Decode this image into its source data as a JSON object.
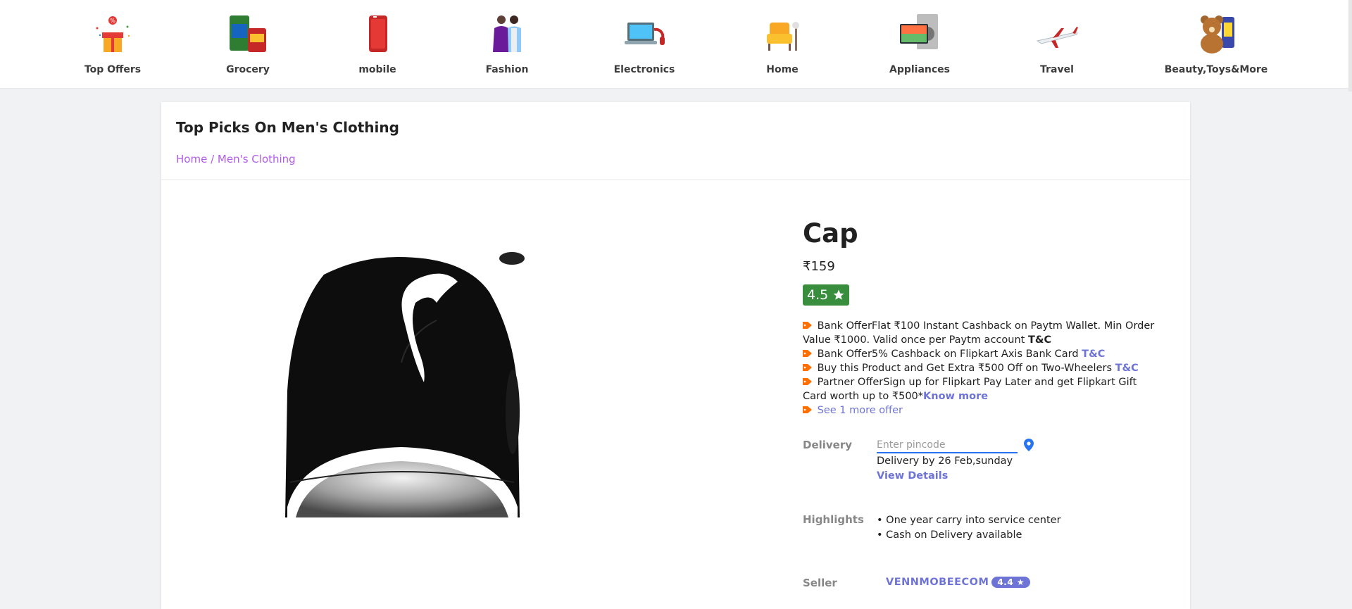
{
  "categories": [
    {
      "label": "Top Offers",
      "icon": "gift-offers-icon"
    },
    {
      "label": "Grocery",
      "icon": "grocery-icon"
    },
    {
      "label": "mobile",
      "icon": "mobile-phone-icon"
    },
    {
      "label": "Fashion",
      "icon": "fashion-icon"
    },
    {
      "label": "Electronics",
      "icon": "laptop-icon"
    },
    {
      "label": "Home",
      "icon": "armchair-icon"
    },
    {
      "label": "Appliances",
      "icon": "appliances-icon"
    },
    {
      "label": "Travel",
      "icon": "airplane-icon"
    },
    {
      "label": "Beauty,Toys&More",
      "icon": "teddy-bear-icon"
    }
  ],
  "section": {
    "title": "Top Picks On Men's Clothing",
    "breadcrumb": [
      "Home",
      "/",
      "Men's Clothing"
    ]
  },
  "product": {
    "name": "Cap",
    "price": "₹159",
    "rating": "4.5",
    "image_icon": "black-cap-icon"
  },
  "offers": [
    {
      "text": "Bank OfferFlat ₹100 Instant Cashback on Paytm Wallet. Min Order Value ₹1000. Valid once per Paytm account ",
      "link": "T&C"
    },
    {
      "text": "Bank Offer5% Cashback on Flipkart Axis Bank Card ",
      "link": "T&C"
    },
    {
      "text": "Buy this Product and Get Extra ₹500 Off on Two-Wheelers ",
      "link": "T&C"
    },
    {
      "text": "Partner OfferSign up for Flipkart Pay Later and get Flipkart Gift Card worth up to ₹500*",
      "link": "Know more"
    },
    {
      "text": "",
      "link": "See 1 more offer"
    }
  ],
  "delivery": {
    "label": "Delivery",
    "placeholder": "Enter pincode",
    "text": "Delivery by 26 Feb,sunday",
    "view_details": "View Details"
  },
  "highlights": {
    "label": "Highlights",
    "items": [
      "One year carry into service center",
      "Cash on Delivery available"
    ]
  },
  "seller": {
    "label": "Seller",
    "name": "VENNMOBEECOM",
    "rating": "4.4 ★"
  },
  "colors": {
    "rating_bg": "#388e3c",
    "link": "#6e74d6",
    "breadcrumb": "#b25be6",
    "tag": "#ff6f00",
    "input_underline": "#2874f0"
  }
}
